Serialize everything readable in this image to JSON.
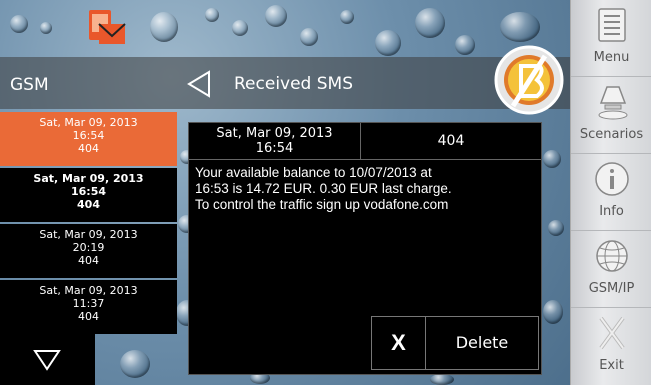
{
  "header": {
    "section_title": "GSM",
    "screen_title": "Received SMS"
  },
  "messages": [
    {
      "date": "Sat, Mar 09, 2013",
      "time": "16:54",
      "number": "404",
      "state": "selected"
    },
    {
      "date": "Sat, Mar 09, 2013",
      "time": "16:54",
      "number": "404",
      "state": "unread"
    },
    {
      "date": "Sat, Mar 09, 2013",
      "time": "20:19",
      "number": "404",
      "state": "read"
    },
    {
      "date": "Sat, Mar 09, 2013",
      "time": "11:37",
      "number": "404",
      "state": "read"
    }
  ],
  "detail": {
    "date": "Sat, Mar 09, 2013",
    "time": "16:54",
    "number": "404",
    "body_line1": "Your available balance to 10/07/2013 at",
    "body_line2": "16:53 is 14.72 EUR. 0.30 EUR last charge.",
    "body_line3": "To control the traffic sign up vodafone.com",
    "close_label": "X",
    "delete_label": "Delete"
  },
  "sidebar": [
    {
      "label": "Menu",
      "icon": "menu-icon"
    },
    {
      "label": "Scenarios",
      "icon": "scenarios-icon"
    },
    {
      "label": "Info",
      "icon": "info-icon"
    },
    {
      "label": "GSM/IP",
      "icon": "globe-icon"
    },
    {
      "label": "Exit",
      "icon": "exit-icon"
    }
  ],
  "colors": {
    "accent": "#ea6a37",
    "panel": "#000000",
    "sidebar": "#e0e1e3"
  }
}
